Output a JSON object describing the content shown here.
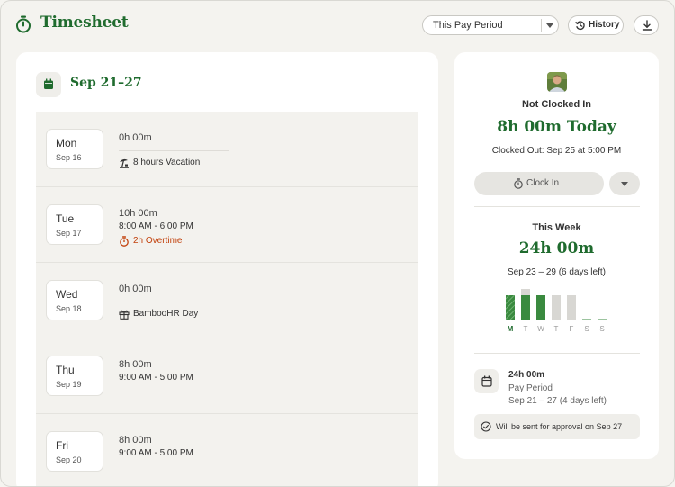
{
  "header": {
    "title": "Timesheet",
    "period_select": "This Pay Period",
    "history_label": "History"
  },
  "timesheet": {
    "range_title": "Sep 21–27",
    "days": [
      {
        "name": "Mon",
        "date": "Sep 16",
        "hours": "0h 00m",
        "note": "8 hours Vacation"
      },
      {
        "name": "Tue",
        "date": "Sep 17",
        "hours": "10h 00m",
        "time": "8:00 AM - 6:00 PM",
        "overtime": "2h Overtime"
      },
      {
        "name": "Wed",
        "date": "Sep 18",
        "hours": "0h 00m",
        "note": "BambooHR Day"
      },
      {
        "name": "Thu",
        "date": "Sep 19",
        "hours": "8h 00m",
        "time": "9:00 AM - 5:00 PM"
      },
      {
        "name": "Fri",
        "date": "Sep 20",
        "hours": "8h 00m",
        "time": "9:00 AM - 5:00 PM"
      }
    ]
  },
  "summary": {
    "status": "Not Clocked In",
    "today_total": "8h 00m Today",
    "clocked_out": "Clocked Out: Sep 25 at 5:00 PM",
    "clock_in_label": "Clock In",
    "week_label": "This Week",
    "week_total": "24h 00m",
    "week_range": "Sep 23 – 29 (6 days left)",
    "pay_period_total": "24h 00m",
    "pay_period_label": "Pay Period",
    "pay_period_range": "Sep 21 – 27 (4 days left)",
    "approval_note": "Will be sent for approval on Sep 27"
  },
  "week_chart": {
    "days": [
      "M",
      "T",
      "W",
      "T",
      "F",
      "S",
      "S"
    ],
    "fill": [
      1.0,
      1.0,
      1.0,
      0.05,
      0.05,
      0.05,
      0.05
    ],
    "planned": [
      1.0,
      1.25,
      1.0,
      1.0,
      1.0,
      0.05,
      0.05
    ],
    "active_index": 0,
    "colors": {
      "worked": "#3a8a3f",
      "planned": "#d8d7d3",
      "accent": "#1f6b2e"
    }
  },
  "colors": {
    "brand": "#1f6b2e",
    "overtime": "#c2410c"
  }
}
